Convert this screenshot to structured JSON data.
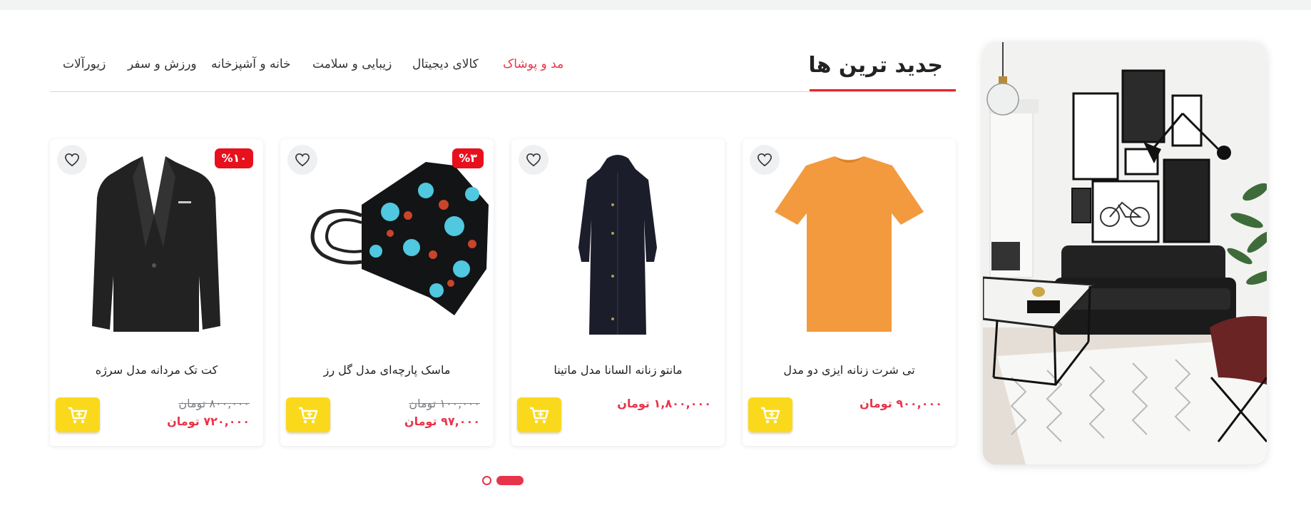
{
  "section": {
    "title": "جدید ترین ها"
  },
  "tabs": [
    {
      "label": "مد و پوشاک",
      "active": true
    },
    {
      "label": "کالای دیجیتال",
      "active": false
    },
    {
      "label": "زیبایی و سلامت",
      "active": false
    },
    {
      "label": "خانه و آشپزخانه",
      "active": false
    },
    {
      "label": "ورزش و سفر",
      "active": false
    },
    {
      "label": "زیورآلات",
      "active": false
    }
  ],
  "products": [
    {
      "name": "تی شرت زنانه ایزی دو مدل",
      "price": "۹۰۰,۰۰۰ تومان",
      "old_price": "",
      "discount": "",
      "image": "orange-tshirt"
    },
    {
      "name": "مانتو زنانه السانا مدل ماتینا",
      "price": "۱,۸۰۰,۰۰۰ تومان",
      "old_price": "",
      "discount": "",
      "image": "black-coat"
    },
    {
      "name": "ماسک پارچه‌ای مدل گل رز",
      "price": "۹۷,۰۰۰ تومان",
      "old_price": "۱۰۰,۰۰۰ تومان",
      "discount": "%۳",
      "image": "flower-mask"
    },
    {
      "name": "کت تک مردانه مدل سرژه",
      "price": "۷۲۰,۰۰۰ تومان",
      "old_price": "۸۰۰,۰۰۰ تومان",
      "discount": "%۱۰",
      "image": "black-blazer"
    }
  ],
  "icons": {
    "wishlist": "heart-icon",
    "cart": "add-to-cart-icon"
  },
  "colors": {
    "accent": "#e8344a",
    "discount_badge": "#e8101d",
    "cart_button": "#fad91c"
  },
  "pager": {
    "pages": 2,
    "current": 2
  }
}
